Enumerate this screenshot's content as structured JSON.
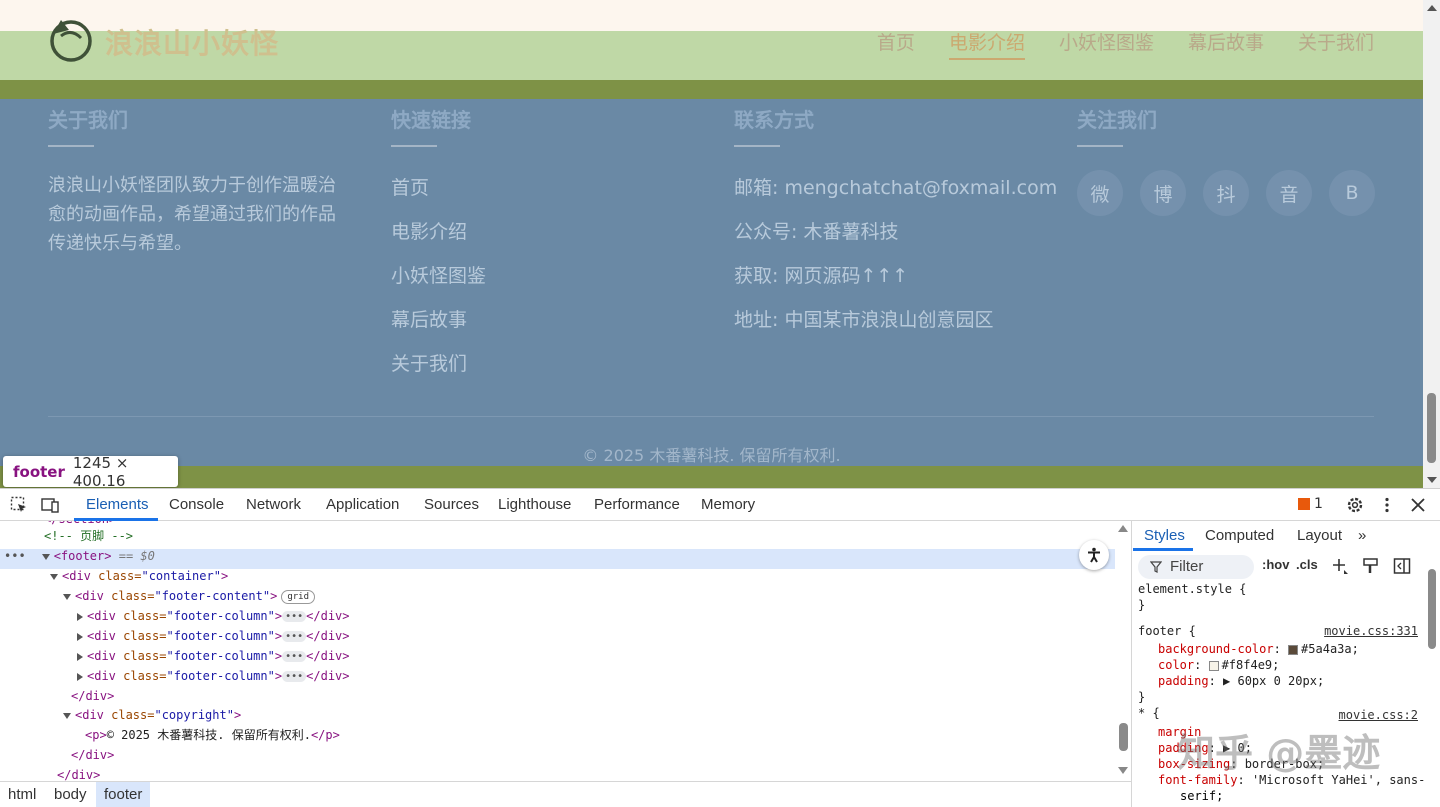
{
  "site": {
    "brand": "浪浪山小妖怪",
    "nav": [
      "首页",
      "电影介绍",
      "小妖怪图鉴",
      "幕后故事",
      "关于我们"
    ],
    "nav_active": "电影介绍"
  },
  "footer": {
    "about": {
      "title": "关于我们",
      "text": "浪浪山小妖怪团队致力于创作温暖治愈的动画作品，希望通过我们的作品传递快乐与希望。"
    },
    "links": {
      "title": "快速链接",
      "items": [
        "首页",
        "电影介绍",
        "小妖怪图鉴",
        "幕后故事",
        "关于我们"
      ]
    },
    "contact": {
      "title": "联系方式",
      "lines": [
        "邮箱: mengchatchat@foxmail.com",
        "公众号: 木番薯科技",
        "获取: 网页源码↑↑↑",
        "地址: 中国某市浪浪山创意园区"
      ]
    },
    "follow": {
      "title": "关注我们",
      "icons": [
        "微",
        "博",
        "抖",
        "音",
        "B"
      ]
    },
    "copyright": "© 2025 木番薯科技. 保留所有权利."
  },
  "inspect_tooltip": {
    "tag": "footer",
    "size": "1245 × 400.16"
  },
  "devtools": {
    "tabs": [
      "Elements",
      "Console",
      "Network",
      "Application",
      "Sources",
      "Lighthouse",
      "Performance",
      "Memory"
    ],
    "active_tab": "Elements",
    "issues_count": "1",
    "dom": {
      "l0": "</section>",
      "l1": "<!-- 页脚 -->",
      "footer_open": "<footer>",
      "footer_eq": "== $0",
      "container_open": "<div ",
      "cls": "class=",
      "container_val": "\"container\"",
      "fc_val": "\"footer-content\"",
      "grid": "grid",
      "col_val": "\"footer-column\"",
      "close_gt": ">",
      "div_close": "</div>",
      "copy_val": "\"copyright\"",
      "p_open": "<p>",
      "p_text": "© 2025 木番薯科技. 保留所有权利.",
      "p_close": "</p>",
      "div_close2": "</div>",
      "div_close3": "</div>"
    },
    "breadcrumbs": [
      "html",
      "body",
      "footer"
    ],
    "styles": {
      "tabs": [
        "Styles",
        "Computed",
        "Layout",
        "»"
      ],
      "filter": "Filter",
      "hov": ":hov",
      "cls": ".cls",
      "element_style": "element.style {",
      "close_brace": "}",
      "footer_sel": "footer {",
      "footer_src": "movie.css:331",
      "p1": "background-color",
      "v1": "#5a4a3a;",
      "c1": "#5a4a3a",
      "p2": "color",
      "v2": "#f8f4e9;",
      "c2": "#f8f4e9",
      "p3": "padding",
      "v3": "▶ 60px 0 20px;",
      "star_sel": "* {",
      "star_src": "movie.css:2",
      "p4": "margin",
      "p5": "padding",
      "v5": "▶ 0;",
      "p6": "box-sizing",
      "v6": "border-box;",
      "p7": "font-family",
      "v7": "'Microsoft YaHei', sans-",
      "v7b": "serif;"
    }
  },
  "watermark": "知乎 @墨迹"
}
